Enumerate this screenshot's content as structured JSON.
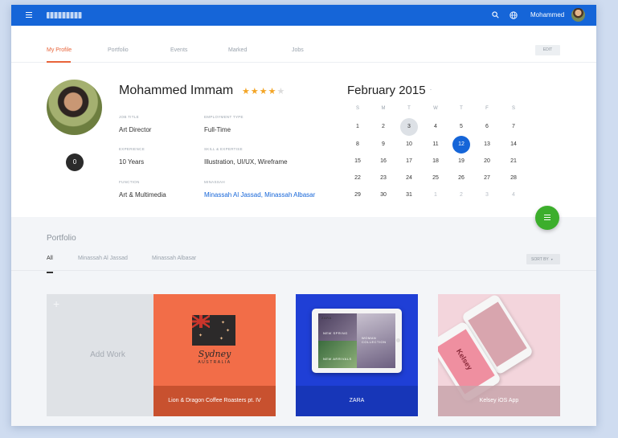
{
  "header": {
    "username": "Mohammed"
  },
  "tabs": [
    {
      "label": "My Profile",
      "active": true
    },
    {
      "label": "Portfolio"
    },
    {
      "label": "Events"
    },
    {
      "label": "Marked"
    },
    {
      "label": "Jobs"
    }
  ],
  "edit_label": "EDIT",
  "profile": {
    "name": "Mohammed Immam",
    "rating": 4,
    "rating_max": 5,
    "badge_count": "0",
    "fields": {
      "job_title": {
        "label": "JOB TITLE",
        "value": "Art Director"
      },
      "employment_type": {
        "label": "EMPLOYMENT TYPE",
        "value": "Full-Time"
      },
      "experience": {
        "label": "EXPERIENCE",
        "value": "10 Years"
      },
      "skill": {
        "label": "SKILL & EXPERTISE",
        "value": "Illustration, UI/UX, Wireframe"
      },
      "function": {
        "label": "FUNCTION",
        "value": "Art & Multimedia"
      },
      "minassah": {
        "label": "MINASSAH",
        "value": "Minassah Al Jassad, Minassah Albasar"
      }
    }
  },
  "calendar": {
    "title": "February 2015",
    "caret": "-",
    "weekdays": [
      "S",
      "M",
      "T",
      "W",
      "T",
      "F",
      "S"
    ],
    "weeks": [
      [
        "1",
        "2",
        "3",
        "4",
        "5",
        "6",
        "7"
      ],
      [
        "8",
        "9",
        "10",
        "11",
        "12",
        "13",
        "14"
      ],
      [
        "15",
        "16",
        "17",
        "18",
        "19",
        "20",
        "21"
      ],
      [
        "22",
        "23",
        "24",
        "25",
        "26",
        "27",
        "28"
      ],
      [
        "29",
        "30",
        "31",
        "1",
        "2",
        "3",
        "4"
      ]
    ],
    "today": "3",
    "selected": "12"
  },
  "portfolio": {
    "title": "Portfolio",
    "tabs": [
      {
        "label": "All",
        "active": true
      },
      {
        "label": "Minassah Al Jassad"
      },
      {
        "label": "Minassah Albasar"
      }
    ],
    "sort_label": "SORT BY",
    "add_label": "Add Work",
    "cards": [
      {
        "caption": "Lion & Dragon Coffee Roasters pt. IV",
        "art_title": "Sydney",
        "art_subtitle": "AUSTRALIA"
      },
      {
        "caption": "ZARA",
        "screen_text_1": "ZARA",
        "screen_text_2": "WOMAN COLLECTION",
        "screen_text_3": "NEW SPRING",
        "screen_text_4": "NEW ARRIVALS"
      },
      {
        "caption": "Kelsey iOS App",
        "art_title": "Kelsey"
      }
    ]
  },
  "colors": {
    "primary": "#1565d8",
    "accent": "#e8643a",
    "fab": "#3cae2c",
    "star": "#f3a526"
  },
  "icons": {
    "menu": "hamburger-icon",
    "search": "search-icon",
    "language": "globe-icon",
    "fab": "list-icon"
  }
}
